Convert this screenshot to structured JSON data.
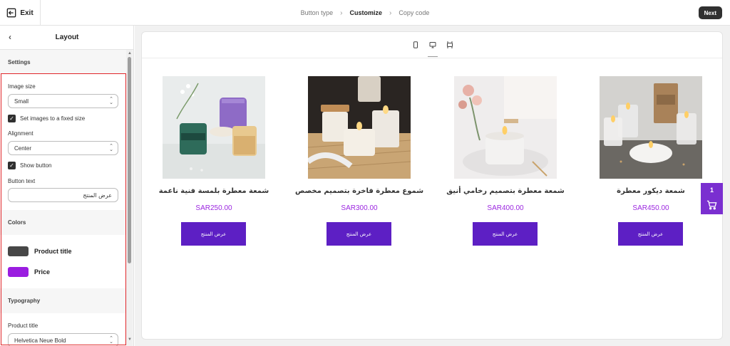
{
  "topbar": {
    "exit_label": "Exit",
    "steps": [
      "Button type",
      "Customize",
      "Copy code"
    ],
    "next_label": "Next"
  },
  "panel": {
    "title": "Layout",
    "settings": {
      "heading": "Settings",
      "image_size_label": "Image size",
      "image_size_value": "Small",
      "fixed_size_label": "Set images to a fixed size",
      "alignment_label": "Alignment",
      "alignment_value": "Center",
      "show_button_label": "Show button",
      "button_text_label": "Button text",
      "button_text_value": "عرض المنتج"
    },
    "colors": {
      "heading": "Colors",
      "items": [
        {
          "label": "Product title",
          "color": "#474747"
        },
        {
          "label": "Price",
          "color": "#9a1de0"
        }
      ]
    },
    "typography": {
      "heading": "Typography",
      "product_title_label": "Product title",
      "product_title_font": "Helvetica Neue Bold"
    }
  },
  "products": [
    {
      "title": "شمعة معطرة بلمسة فنية ناعمة",
      "price": "SAR250.00",
      "button": "عرض المنتج"
    },
    {
      "title": "شموع معطرة فاخرة بتصميم مخصص",
      "price": "SAR300.00",
      "button": "عرض المنتج"
    },
    {
      "title": "شمعة معطرة بتصميم رخامي أنيق",
      "price": "SAR400.00",
      "button": "عرض المنتج"
    },
    {
      "title": "شمعة ديكور معطرة",
      "price": "SAR450.00",
      "button": "عرض المنتج"
    }
  ],
  "cart": {
    "count": "1"
  },
  "colors": {
    "accent_button": "#5d1fc4",
    "price": "#9c27e0",
    "cart": "#7a2fd0"
  }
}
